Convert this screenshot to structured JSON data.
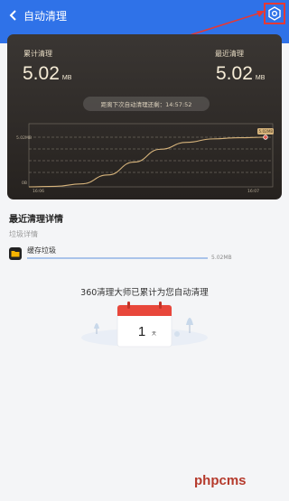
{
  "header": {
    "back_icon": "chevron-left-icon",
    "title": "自动清理",
    "settings_icon": "gear-icon",
    "bg_color": "#2f72e8",
    "highlight_color": "#e53935"
  },
  "summary": {
    "total_label": "累计清理",
    "total_value": "5.02",
    "total_unit": "MB",
    "recent_label": "最近清理",
    "recent_value": "5.02",
    "recent_unit": "MB",
    "countdown_text": "距离下次自动清理还剩：14:57:52"
  },
  "chart_data": {
    "type": "line",
    "y_labels": [
      "5.02MB",
      "0B"
    ],
    "x_labels": [
      "16:06",
      "16:07"
    ],
    "point_label": "5.02MB",
    "values": [
      0,
      0.05,
      0.3,
      1.2,
      2.5,
      3.8,
      4.5,
      4.85,
      4.97,
      5.02
    ],
    "ylim": [
      0,
      5.02
    ],
    "line_color": "#d7b47c"
  },
  "details": {
    "section_title": "最近清理详情",
    "sub_label": "垃圾详情",
    "items": [
      {
        "icon": "folder-icon",
        "name": "缓存垃圾",
        "size": "5.02MB",
        "progress": 1.0
      }
    ]
  },
  "footer": {
    "message": "360清理大师已累计为您自动清理",
    "days_value": "1",
    "days_unit": "天",
    "calendar_icon": "calendar-icon"
  },
  "watermark": "phpcms"
}
